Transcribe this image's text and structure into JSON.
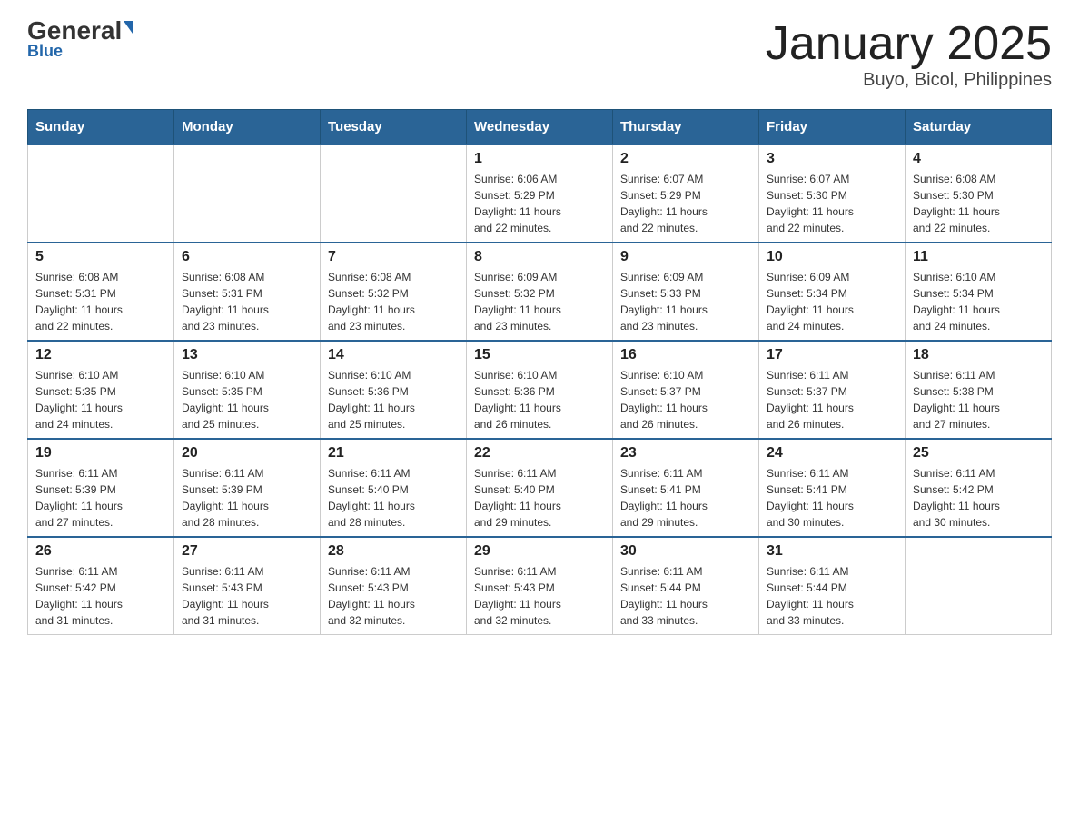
{
  "header": {
    "logo_main": "General",
    "logo_sub": "Blue",
    "month_title": "January 2025",
    "location": "Buyo, Bicol, Philippines"
  },
  "weekdays": [
    "Sunday",
    "Monday",
    "Tuesday",
    "Wednesday",
    "Thursday",
    "Friday",
    "Saturday"
  ],
  "weeks": [
    [
      {
        "day": "",
        "info": ""
      },
      {
        "day": "",
        "info": ""
      },
      {
        "day": "",
        "info": ""
      },
      {
        "day": "1",
        "info": "Sunrise: 6:06 AM\nSunset: 5:29 PM\nDaylight: 11 hours\nand 22 minutes."
      },
      {
        "day": "2",
        "info": "Sunrise: 6:07 AM\nSunset: 5:29 PM\nDaylight: 11 hours\nand 22 minutes."
      },
      {
        "day": "3",
        "info": "Sunrise: 6:07 AM\nSunset: 5:30 PM\nDaylight: 11 hours\nand 22 minutes."
      },
      {
        "day": "4",
        "info": "Sunrise: 6:08 AM\nSunset: 5:30 PM\nDaylight: 11 hours\nand 22 minutes."
      }
    ],
    [
      {
        "day": "5",
        "info": "Sunrise: 6:08 AM\nSunset: 5:31 PM\nDaylight: 11 hours\nand 22 minutes."
      },
      {
        "day": "6",
        "info": "Sunrise: 6:08 AM\nSunset: 5:31 PM\nDaylight: 11 hours\nand 23 minutes."
      },
      {
        "day": "7",
        "info": "Sunrise: 6:08 AM\nSunset: 5:32 PM\nDaylight: 11 hours\nand 23 minutes."
      },
      {
        "day": "8",
        "info": "Sunrise: 6:09 AM\nSunset: 5:32 PM\nDaylight: 11 hours\nand 23 minutes."
      },
      {
        "day": "9",
        "info": "Sunrise: 6:09 AM\nSunset: 5:33 PM\nDaylight: 11 hours\nand 23 minutes."
      },
      {
        "day": "10",
        "info": "Sunrise: 6:09 AM\nSunset: 5:34 PM\nDaylight: 11 hours\nand 24 minutes."
      },
      {
        "day": "11",
        "info": "Sunrise: 6:10 AM\nSunset: 5:34 PM\nDaylight: 11 hours\nand 24 minutes."
      }
    ],
    [
      {
        "day": "12",
        "info": "Sunrise: 6:10 AM\nSunset: 5:35 PM\nDaylight: 11 hours\nand 24 minutes."
      },
      {
        "day": "13",
        "info": "Sunrise: 6:10 AM\nSunset: 5:35 PM\nDaylight: 11 hours\nand 25 minutes."
      },
      {
        "day": "14",
        "info": "Sunrise: 6:10 AM\nSunset: 5:36 PM\nDaylight: 11 hours\nand 25 minutes."
      },
      {
        "day": "15",
        "info": "Sunrise: 6:10 AM\nSunset: 5:36 PM\nDaylight: 11 hours\nand 26 minutes."
      },
      {
        "day": "16",
        "info": "Sunrise: 6:10 AM\nSunset: 5:37 PM\nDaylight: 11 hours\nand 26 minutes."
      },
      {
        "day": "17",
        "info": "Sunrise: 6:11 AM\nSunset: 5:37 PM\nDaylight: 11 hours\nand 26 minutes."
      },
      {
        "day": "18",
        "info": "Sunrise: 6:11 AM\nSunset: 5:38 PM\nDaylight: 11 hours\nand 27 minutes."
      }
    ],
    [
      {
        "day": "19",
        "info": "Sunrise: 6:11 AM\nSunset: 5:39 PM\nDaylight: 11 hours\nand 27 minutes."
      },
      {
        "day": "20",
        "info": "Sunrise: 6:11 AM\nSunset: 5:39 PM\nDaylight: 11 hours\nand 28 minutes."
      },
      {
        "day": "21",
        "info": "Sunrise: 6:11 AM\nSunset: 5:40 PM\nDaylight: 11 hours\nand 28 minutes."
      },
      {
        "day": "22",
        "info": "Sunrise: 6:11 AM\nSunset: 5:40 PM\nDaylight: 11 hours\nand 29 minutes."
      },
      {
        "day": "23",
        "info": "Sunrise: 6:11 AM\nSunset: 5:41 PM\nDaylight: 11 hours\nand 29 minutes."
      },
      {
        "day": "24",
        "info": "Sunrise: 6:11 AM\nSunset: 5:41 PM\nDaylight: 11 hours\nand 30 minutes."
      },
      {
        "day": "25",
        "info": "Sunrise: 6:11 AM\nSunset: 5:42 PM\nDaylight: 11 hours\nand 30 minutes."
      }
    ],
    [
      {
        "day": "26",
        "info": "Sunrise: 6:11 AM\nSunset: 5:42 PM\nDaylight: 11 hours\nand 31 minutes."
      },
      {
        "day": "27",
        "info": "Sunrise: 6:11 AM\nSunset: 5:43 PM\nDaylight: 11 hours\nand 31 minutes."
      },
      {
        "day": "28",
        "info": "Sunrise: 6:11 AM\nSunset: 5:43 PM\nDaylight: 11 hours\nand 32 minutes."
      },
      {
        "day": "29",
        "info": "Sunrise: 6:11 AM\nSunset: 5:43 PM\nDaylight: 11 hours\nand 32 minutes."
      },
      {
        "day": "30",
        "info": "Sunrise: 6:11 AM\nSunset: 5:44 PM\nDaylight: 11 hours\nand 33 minutes."
      },
      {
        "day": "31",
        "info": "Sunrise: 6:11 AM\nSunset: 5:44 PM\nDaylight: 11 hours\nand 33 minutes."
      },
      {
        "day": "",
        "info": ""
      }
    ]
  ]
}
